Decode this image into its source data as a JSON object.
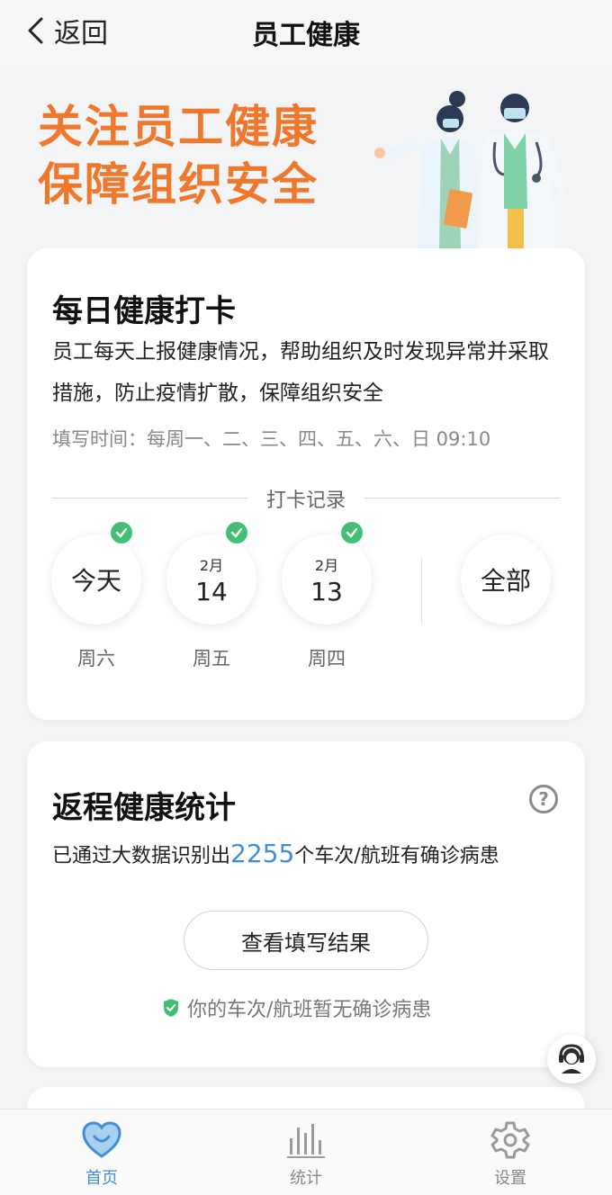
{
  "header": {
    "back_label": "返回",
    "title": "员工健康"
  },
  "banner": {
    "line1": "关注员工健康",
    "line2": "保障组织安全"
  },
  "checkin_card": {
    "title": "每日健康打卡",
    "description": "员工每天上报健康情况，帮助组织及时发现异常并采取措施，防止疫情扩散，保障组织安全",
    "fill_time": "填写时间：每周一、二、三、四、五、六、日 09:10",
    "record_label": "打卡记录",
    "days": [
      {
        "main": "今天",
        "month": "",
        "weekday": "周六",
        "checked": true
      },
      {
        "main": "14",
        "month": "2月",
        "weekday": "周五",
        "checked": true
      },
      {
        "main": "13",
        "month": "2月",
        "weekday": "周四",
        "checked": true
      }
    ],
    "all_label": "全部"
  },
  "return_card": {
    "title": "返程健康统计",
    "stat_prefix": "已通过大数据识别出",
    "stat_number": "2255",
    "stat_suffix": "个车次/航班有确诊病患",
    "view_button": "查看填写结果",
    "safe_text": "你的车次/航班暂无确诊病患"
  },
  "tabbar": {
    "items": [
      {
        "label": "首页",
        "icon": "heart-icon",
        "active": true
      },
      {
        "label": "统计",
        "icon": "bar-chart-icon",
        "active": false
      },
      {
        "label": "设置",
        "icon": "gear-icon",
        "active": false
      }
    ]
  },
  "colors": {
    "accent": "#3f8fd6",
    "slogan": "#f0782c",
    "check": "#43bf74"
  }
}
